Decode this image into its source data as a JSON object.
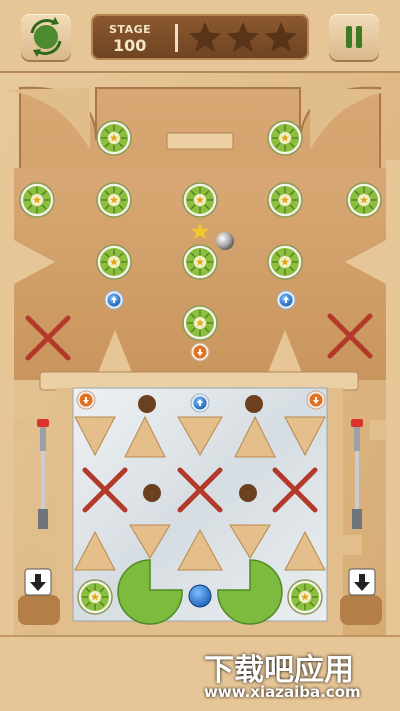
{
  "hud": {
    "restart_icon": "circular-arrows-restart-icon",
    "stage_label": "STAGE",
    "stage_number": "100",
    "stars_total": 3,
    "stars_earned": 0,
    "pause_icon": "pause-icon"
  },
  "board": {
    "targets": "kiwi-slice",
    "boosters": "blue-up-arrow",
    "reverse": "orange-down-arrow",
    "bonus": "yellow-star",
    "ball": "silver-ball",
    "left_launcher": "plunger",
    "right_launcher": "plunger",
    "drop_arrows": "down-arrow"
  },
  "colors": {
    "wood_light": "#e7c699",
    "wood_mid": "#d4a56b",
    "wood_dark": "#9a6a3c",
    "panel_brown": "#7a4a25",
    "cross_red": "#b3392a",
    "kiwi_green": "#7fb43a",
    "blue_button": "#2f7fd6",
    "orange_button": "#e0711e",
    "pacman_green": "#7dbb3f"
  },
  "watermark": {
    "cn_text": "下载吧应用",
    "url_text": "www.xiazaiba.com"
  }
}
